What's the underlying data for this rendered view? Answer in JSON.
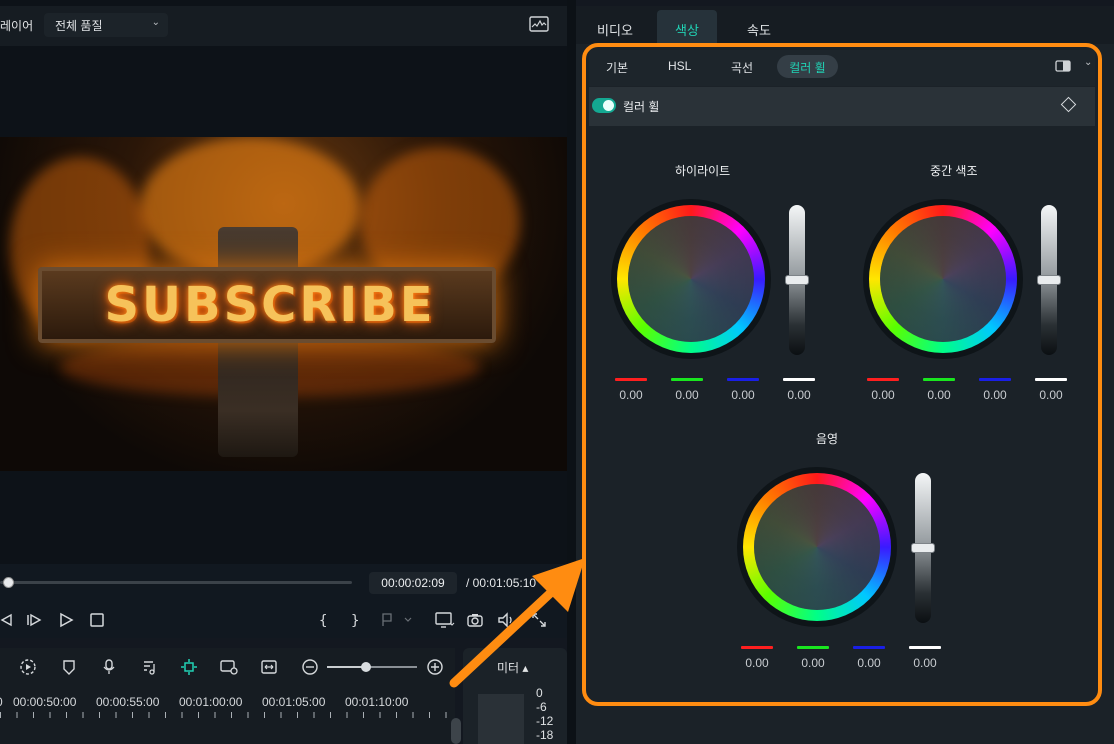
{
  "player": {
    "title": "레이어",
    "quality": "전체 품질",
    "preview_text": "SUBSCRIBE",
    "current_time": "00:00:02:09",
    "total_time": "/  00:01:05:10",
    "progress": 0.02
  },
  "timeline": {
    "ruler_labels": [
      "0",
      "00:00:50:00",
      "00:00:55:00",
      "00:01:00:00",
      "00:01:05:00",
      "00:01:10:00"
    ],
    "zoom_level": 0.43,
    "meter_label": "미터 ▴",
    "meter_values": [
      "0",
      "-6",
      "-12",
      "-18"
    ]
  },
  "right_panel": {
    "tabs": [
      "비디오",
      "색상",
      "속도"
    ],
    "active_tab": "색상",
    "sub_tabs": [
      "기본",
      "HSL",
      "곡선",
      "컬러 휠"
    ],
    "active_sub_tab": "컬러 휠",
    "section_title": "컬러 휠",
    "section_enabled": true,
    "wheels": [
      {
        "title": "하이라이트",
        "values": [
          "0.00",
          "0.00",
          "0.00",
          "0.00"
        ],
        "slider_level": 0.5
      },
      {
        "title": "중간 색조",
        "values": [
          "0.00",
          "0.00",
          "0.00",
          "0.00"
        ],
        "slider_level": 0.5
      },
      {
        "title": "음영",
        "values": [
          "0.00",
          "0.00",
          "0.00",
          "0.00"
        ],
        "slider_level": 0.5
      }
    ],
    "channel_colors": [
      "#ff1f1f",
      "#19e61f",
      "#1a1fe6",
      "#ffffff"
    ],
    "accent_color": "#21d1b4",
    "highlight_frame_color": "#ff8c11"
  }
}
